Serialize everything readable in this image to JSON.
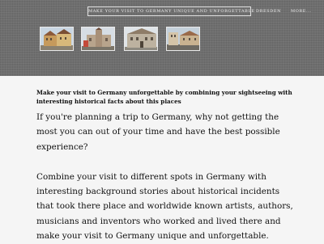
{
  "nav": {
    "main_link": "MAKE YOUR VISIT TO GERMANY UNIQUE AND UNFORGETTABLE",
    "dresden": "DRESDEN",
    "more": "MORE..."
  },
  "header": {
    "thumbnails": [
      {
        "icon": "town-photo"
      },
      {
        "icon": "castle-photo"
      },
      {
        "icon": "building-photo"
      },
      {
        "icon": "street-photo"
      }
    ]
  },
  "post": {
    "title": "Make your visit to Germany unforgettable by combining your sightseeing with interesting historical facts about this places",
    "paragraphs": [
      "If you're planning a trip to Germany, why not getting the most you can out of your time and have the best possible experience?",
      "Combine your visit to different spots in Germany with interesting background stories about historical incidents that took there place and worldwide known artists, authors, musicians and inventors who worked and lived there and make your visit to Germany unique and unforgettable."
    ]
  }
}
